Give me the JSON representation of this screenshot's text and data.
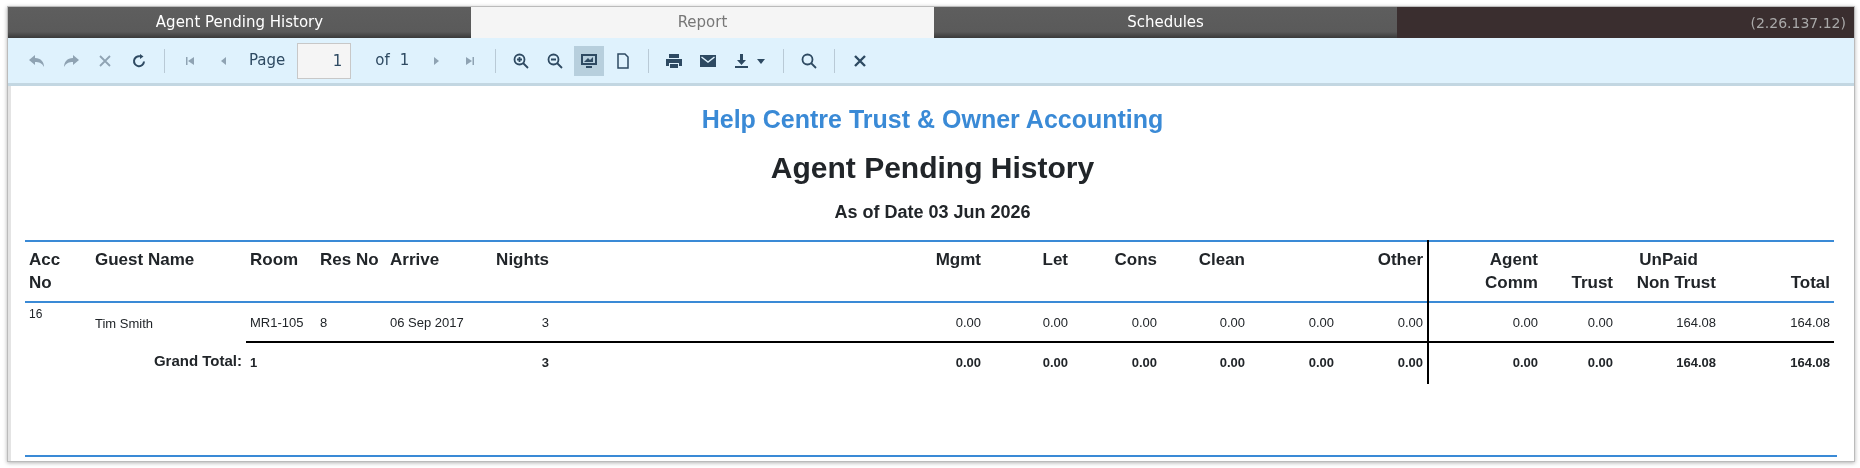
{
  "tabs": [
    {
      "label": "Agent Pending History",
      "selected": false
    },
    {
      "label": "Report",
      "selected": true
    },
    {
      "label": "Schedules",
      "selected": false
    }
  ],
  "version": "(2.26.137.12)",
  "toolbar": {
    "tools": [
      {
        "kind": "undo",
        "disabled": true
      },
      {
        "kind": "redo",
        "disabled": true
      },
      {
        "kind": "stop",
        "disabled": true
      },
      {
        "kind": "refresh",
        "disabled": false
      },
      {
        "kind": "separator"
      },
      {
        "kind": "first",
        "disabled": true
      },
      {
        "kind": "prev",
        "disabled": true
      },
      {
        "kind": "page_label",
        "text": "Page"
      },
      {
        "kind": "page_field",
        "value": "1"
      },
      {
        "kind": "page_of",
        "text": "of"
      },
      {
        "kind": "page_count",
        "text": "1"
      },
      {
        "kind": "next",
        "disabled": true
      },
      {
        "kind": "last",
        "disabled": true
      },
      {
        "kind": "separator"
      },
      {
        "kind": "zoom_in",
        "disabled": false
      },
      {
        "kind": "zoom_out",
        "disabled": false
      },
      {
        "kind": "screen",
        "disabled": false,
        "selected": true
      },
      {
        "kind": "page",
        "disabled": false,
        "selected": false
      },
      {
        "kind": "separator"
      },
      {
        "kind": "print",
        "disabled": false
      },
      {
        "kind": "mail",
        "disabled": false
      },
      {
        "kind": "download",
        "disabled": false
      },
      {
        "kind": "separator"
      },
      {
        "kind": "search",
        "disabled": false
      },
      {
        "kind": "separator"
      },
      {
        "kind": "close",
        "disabled": false
      }
    ]
  },
  "report": {
    "company": "Help Centre Trust & Owner Accounting",
    "title": "Agent Pending History",
    "subtitle": "As of Date 03 Jun 2026",
    "table": {
      "columns": [
        {
          "label": "Acc No"
        },
        {
          "label": "Guest Name"
        },
        {
          "label": "Room"
        },
        {
          "label": "Res No"
        },
        {
          "label": "Arrive"
        },
        {
          "label": "Nights"
        },
        {
          "label": "Mgmt"
        },
        {
          "label": "Let"
        },
        {
          "label": "Cons"
        },
        {
          "label": "Clean"
        },
        {},
        {
          "label": "Other"
        },
        {
          "label": "Agent Comm"
        },
        {
          "label": "Trust"
        },
        {
          "label": "Non Trust",
          "group": "UnPaid"
        },
        {
          "label": "Total"
        }
      ],
      "rows": [
        [
          "16",
          "Tim Smith",
          "MR1-105",
          "8",
          "06 Sep 2017",
          "3",
          "0.00",
          "0.00",
          "0.00",
          "0.00",
          "0.00",
          "0.00",
          "0.00",
          "0.00",
          "164.08",
          "164.08"
        ]
      ],
      "total": {
        "label": "Grand Total:",
        "cells": [
          "1",
          null,
          null,
          "3",
          "0.00",
          "0.00",
          "0.00",
          "0.00",
          "0.00",
          "0.00",
          "0.00",
          "0.00",
          "164.08",
          "164.08"
        ]
      }
    }
  }
}
